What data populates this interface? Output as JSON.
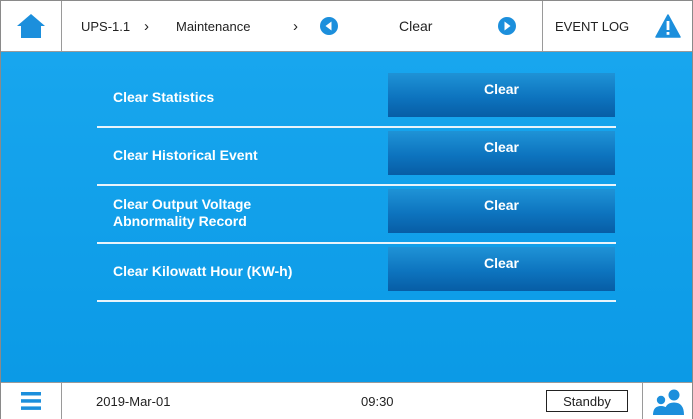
{
  "header": {
    "breadcrumb": [
      {
        "label": "UPS-1.1"
      },
      {
        "label": "Maintenance"
      }
    ],
    "page_title": "Clear",
    "event_log_label": "EVENT LOG"
  },
  "rows": [
    {
      "label": "Clear Statistics",
      "button": "Clear"
    },
    {
      "label": "Clear Historical Event",
      "button": "Clear"
    },
    {
      "label": "Clear Output Voltage\nAbnormality Record",
      "button": "Clear"
    },
    {
      "label": "Clear Kilowatt Hour (KW-h)",
      "button": "Clear"
    }
  ],
  "footer": {
    "date": "2019-Mar-01",
    "time": "09:30",
    "status": "Standby"
  },
  "icons": {
    "home": "home-icon",
    "prev": "arrow-left-circle-icon",
    "next": "arrow-right-circle-icon",
    "alarm": "warning-triangle-icon",
    "menu": "hamburger-menu-icon",
    "user": "users-icon"
  },
  "colors": {
    "accent": "#0b9ae6",
    "button": "#0d74bf",
    "icon": "#1c8fdc"
  }
}
